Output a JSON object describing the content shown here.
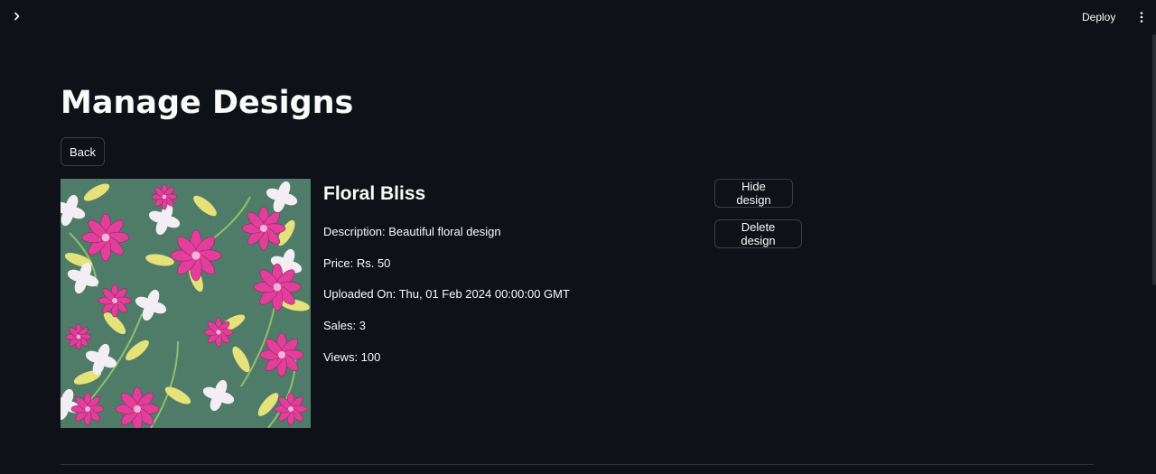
{
  "header": {
    "deploy_label": "Deploy",
    "expand_icon": "chevron-right-icon",
    "menu_icon": "more-vertical-icon"
  },
  "page": {
    "title": "Manage Designs",
    "back_label": "Back"
  },
  "design": {
    "name": "Floral Bliss",
    "description": "Description: Beautiful floral design",
    "price": "Price: Rs. 50",
    "uploaded": "Uploaded On: Thu, 01 Feb 2024 00:00:00 GMT",
    "sales": "Sales: 3",
    "views": "Views: 100",
    "image_alt": "floral pattern design preview",
    "hide_label": "Hide design",
    "delete_label": "Delete design"
  },
  "colors": {
    "background": "#0e1117",
    "text": "#fafafa",
    "button_border": "#3a3d45",
    "pattern_bg": "#4f7c68",
    "petal_pink": "#e03f9a",
    "leaf_yellow": "#e6e27a",
    "petal_white": "#f2eef4"
  }
}
